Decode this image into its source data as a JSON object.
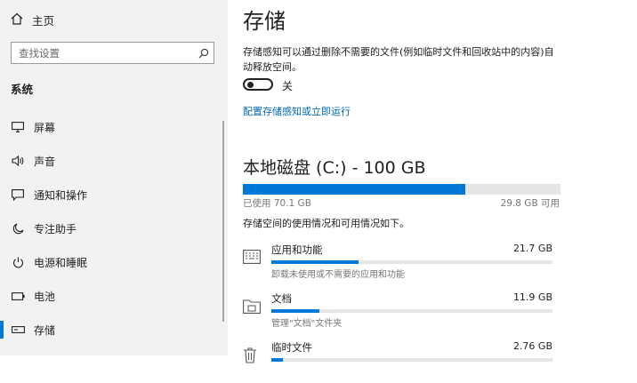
{
  "sidebar": {
    "home_label": "主页",
    "search_placeholder": "查找设置",
    "section_title": "系统",
    "items": [
      {
        "label": "屏幕",
        "icon": "monitor-icon"
      },
      {
        "label": "声音",
        "icon": "speaker-icon"
      },
      {
        "label": "通知和操作",
        "icon": "notification-icon"
      },
      {
        "label": "专注助手",
        "icon": "moon-icon"
      },
      {
        "label": "电源和睡眠",
        "icon": "power-icon"
      },
      {
        "label": "电池",
        "icon": "battery-icon"
      },
      {
        "label": "存储",
        "icon": "storage-icon",
        "active": true
      }
    ]
  },
  "main": {
    "title": "存储",
    "description": "存储感知可以通过删除不需要的文件(例如临时文件和回收站中的内容)自动释放空间。",
    "toggle": {
      "label": "关",
      "on": false
    },
    "config_link": "配置存储感知或立即运行",
    "drive": {
      "title": "本地磁盘 (C:) - 100 GB",
      "used_label": "已使用 70.1 GB",
      "free_label": "29.8 GB 可用",
      "used_fraction": 0.701
    },
    "usage_intro": "存储空间的使用情况和可用情况如下。",
    "categories": [
      {
        "name": "应用和功能",
        "size": "21.7 GB",
        "sub": "卸载未使用或不需要的应用和功能",
        "fraction": 0.31,
        "icon": "apps-icon"
      },
      {
        "name": "文档",
        "size": "11.9 GB",
        "sub": "管理\"文档\"文件夹",
        "fraction": 0.17,
        "icon": "folder-icon"
      },
      {
        "name": "临时文件",
        "size": "2.76 GB",
        "sub": "",
        "fraction": 0.04,
        "icon": "trash-icon"
      }
    ]
  },
  "colors": {
    "accent": "#0078d7",
    "link": "#0067b8",
    "sidebar_bg": "#f2f2f2",
    "bar_track": "#e6e6e6"
  }
}
